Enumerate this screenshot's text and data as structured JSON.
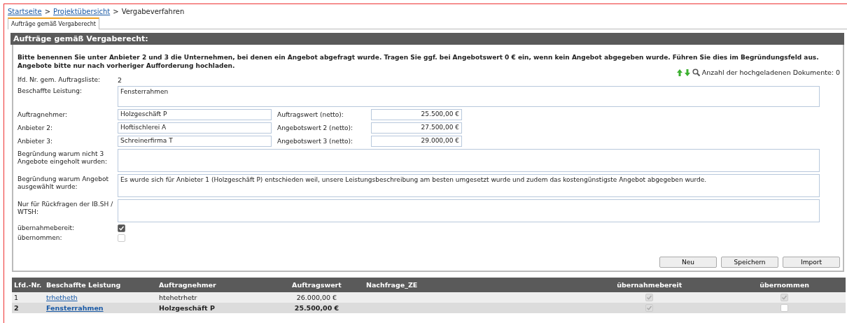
{
  "breadcrumb": [
    {
      "label": "Startseite",
      "kind": "link"
    },
    {
      "label": ">",
      "kind": "separator"
    },
    {
      "label": "Projektübersicht",
      "kind": "link"
    },
    {
      "label": ">",
      "kind": "separator"
    },
    {
      "label": "Vergabeverfahren",
      "kind": "current"
    }
  ],
  "tabs": [
    {
      "label": "Aufträge gemäß Vergaberecht",
      "selected": true
    }
  ],
  "section_title": "Aufträge gemäß Vergaberecht:",
  "notice": "Bitte benennen Sie unter Anbieter 2 und 3 die Unternehmen, bei denen ein Angebot abgefragt wurde. Tragen Sie ggf. bei Angebotswert 0 € ein, wenn kein Angebot abgegeben wurde. Führen Sie dies im Begründungsfeld aus. Angebote bitte nur nach vorheriger Aufforderung hochladen.",
  "documents": {
    "label": "Anzahl der hochgeladenen Dokumente: 0"
  },
  "form": {
    "number_label": "lfd. Nr. gem. Auftragsliste:",
    "number_value": "2",
    "fields": [
      {
        "kind": "textarea",
        "label": "Beschaffte Leistung:",
        "value": "Fensterrahmen"
      },
      {
        "kind": "pair",
        "label": "Auftragnehmer:",
        "value": "Holzgeschäft P",
        "amount_label": "Auftragswert (netto):",
        "amount": "25.500,00 €"
      },
      {
        "kind": "pair",
        "label": "Anbieter 2:",
        "value": "Hoftischlerei A",
        "amount_label": "Angebotswert 2 (netto):",
        "amount": "27.500,00 €"
      },
      {
        "kind": "pair",
        "label": "Anbieter 3:",
        "value": "Schreinerfirma T",
        "amount_label": "Angebotswert 3 (netto):",
        "amount": "29.000,00 €"
      },
      {
        "kind": "textarea",
        "label": "Begründung warum nicht 3 Angebote eingeholt wurden:"
      },
      {
        "kind": "textarea",
        "label": "Begründung warum Angebot ausgewählt wurde:",
        "value": "Es wurde sich für Anbieter 1 (Holzgeschäft P) entschieden weil, unsere Leistungsbeschreibung am besten umgesetzt wurde und zudem das kostengünstigste Angebot abgegeben wurde."
      },
      {
        "kind": "textarea",
        "label": "Nur für Rückfragen der IB.SH / WTSH:"
      },
      {
        "kind": "checkbox",
        "label": "übernahmebereit:",
        "checked": true,
        "disabled": false
      },
      {
        "kind": "checkbox",
        "label": "übernommen:",
        "checked": false,
        "disabled": true
      }
    ]
  },
  "buttons": [
    "Neu",
    "Speichern",
    "Import"
  ],
  "table": {
    "columns": [
      "Lfd.-Nr.",
      "Beschaffte Leistung",
      "Auftragnehmer",
      "Auftragswert",
      "Nachfrage_ZE",
      "übernahmebereit",
      "übernommen"
    ],
    "rows": [
      {
        "selected": false,
        "nr": "1",
        "leistung": "trhetheth",
        "auftragnehmer": "htehetrhetr",
        "wert": "26.000,00 €",
        "uebernahmebereit": true,
        "uebernommen": true
      },
      {
        "selected": true,
        "nr": "2",
        "leistung": "Fensterrahmen",
        "auftragnehmer": "Holzgeschäft P",
        "wert": "25.500,00 €",
        "uebernahmebereit": true,
        "uebernommen": false
      }
    ]
  }
}
